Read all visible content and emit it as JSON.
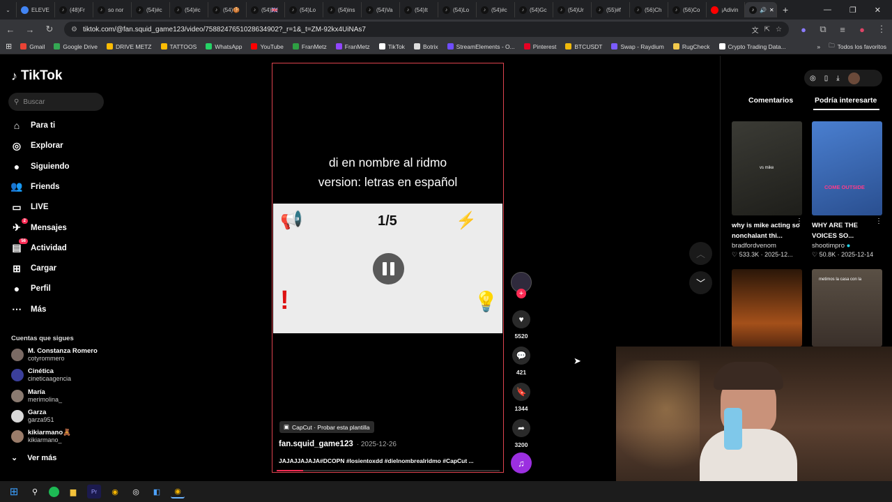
{
  "browser": {
    "tabs": [
      {
        "label": "ELEVE",
        "icon": "globe-icon"
      },
      {
        "label": "(48)Fr",
        "icon": "tiktok-icon"
      },
      {
        "label": "so nor",
        "icon": "tiktok-icon"
      },
      {
        "label": "(54)#c",
        "icon": "tiktok-icon"
      },
      {
        "label": "(54)#c",
        "icon": "tiktok-icon"
      },
      {
        "label": "(54)🍪",
        "icon": "tiktok-icon"
      },
      {
        "label": "(54)🇬🇧",
        "icon": "tiktok-icon"
      },
      {
        "label": "(54)Lo",
        "icon": "tiktok-icon"
      },
      {
        "label": "(54)ins",
        "icon": "tiktok-icon"
      },
      {
        "label": "(54)Va",
        "icon": "tiktok-icon"
      },
      {
        "label": "(54)It",
        "icon": "tiktok-icon"
      },
      {
        "label": "(54)Lo",
        "icon": "tiktok-icon"
      },
      {
        "label": "(54)#c",
        "icon": "tiktok-icon"
      },
      {
        "label": "(54)Gc",
        "icon": "tiktok-icon"
      },
      {
        "label": "(54)Ur",
        "icon": "tiktok-icon"
      },
      {
        "label": "(55)#f",
        "icon": "tiktok-icon"
      },
      {
        "label": "(56)Ch",
        "icon": "tiktok-icon"
      },
      {
        "label": "(56)Co",
        "icon": "tiktok-icon"
      },
      {
        "label": "¡Adivin",
        "icon": "youtube-icon"
      }
    ],
    "url": "tiktok.com/@fan.squid_game123/video/7588247651028634902?_r=1&_t=ZM-92kx4UiNAs7",
    "bookmarks": [
      {
        "label": "Gmail",
        "color": "#ea4335"
      },
      {
        "label": "Google Drive",
        "color": "#34a853"
      },
      {
        "label": "DRIVE METZ",
        "color": "#fbbc04"
      },
      {
        "label": "TATTOOS",
        "color": "#fbbc04"
      },
      {
        "label": "WhatsApp",
        "color": "#25d366"
      },
      {
        "label": "YouTube",
        "color": "#ff0000"
      },
      {
        "label": "FranMetz",
        "color": "#2ea043"
      },
      {
        "label": "FranMetz",
        "color": "#9146ff"
      },
      {
        "label": "TikTok",
        "color": "#ffffff"
      },
      {
        "label": "Botrix",
        "color": "#dddddd"
      },
      {
        "label": "StreamElements - O...",
        "color": "#6f4dff"
      },
      {
        "label": "Pinterest",
        "color": "#e60023"
      },
      {
        "label": "BTCUSDT",
        "color": "#f0b90b"
      },
      {
        "label": "Swap - Raydium",
        "color": "#7b5cff"
      },
      {
        "label": "RugCheck",
        "color": "#f2c94c"
      },
      {
        "label": "Crypto Trading Data...",
        "color": "#ffffff"
      }
    ],
    "all_bookmarks": "Todos los favoritos"
  },
  "sidebar": {
    "logo": "TikTok",
    "search_placeholder": "Buscar",
    "nav": [
      {
        "label": "Para ti",
        "icon": "home-icon"
      },
      {
        "label": "Explorar",
        "icon": "compass-icon"
      },
      {
        "label": "Siguiendo",
        "icon": "following-icon"
      },
      {
        "label": "Friends",
        "icon": "friends-icon"
      },
      {
        "label": "LIVE",
        "icon": "live-icon"
      },
      {
        "label": "Mensajes",
        "icon": "messages-icon",
        "badge": "2"
      },
      {
        "label": "Actividad",
        "icon": "activity-icon",
        "badge": "56"
      },
      {
        "label": "Cargar",
        "icon": "upload-icon"
      },
      {
        "label": "Perfil",
        "icon": "profile-icon"
      },
      {
        "label": "Más",
        "icon": "more-icon"
      }
    ],
    "following_title": "Cuentas que sigues",
    "accounts": [
      {
        "name": "M. Constanza Romero",
        "handle": "cotyrommero"
      },
      {
        "name": "Cinética",
        "handle": "cineticaagencia"
      },
      {
        "name": "María",
        "handle": "merimolina_"
      },
      {
        "name": "Garza",
        "handle": "garza951"
      },
      {
        "name": "kikiarmano🧸",
        "handle": "kikiarmano_"
      }
    ],
    "see_more": "Ver más"
  },
  "video": {
    "overlay_line1": "di en nombre al ridmo",
    "overlay_line2": "version: letras en español",
    "counter": "1/5",
    "capcut_label": "CapCut · Probar esta plantilla",
    "author": "fan.squid_game123",
    "date": "· 2025-12-26",
    "caption": "JAJAJJAJAJA#DCOPN #losientoxdd #dielnombrealridmo #CapCut ...",
    "progress": 0.12
  },
  "actions": {
    "likes": "5520",
    "comments": "421",
    "saves": "1344",
    "shares": "3200"
  },
  "right_panel": {
    "tab_comments": "Comentarios",
    "tab_suggestions": "Podría interesarte",
    "cards": [
      {
        "title": "why is mike acting so nonchalant thi...",
        "overlay": "vs mike",
        "author": "bradfordvenom",
        "likes": "533.3K",
        "date": "2025-12..."
      },
      {
        "title": "WHY ARE THE VOICES SO...",
        "overlay": "COME OUTSIDE",
        "author": "shootimpro",
        "likes": "50.8K",
        "date": "2025-12-14"
      },
      {
        "title": "",
        "overlay": "",
        "author": "",
        "likes": "",
        "date": ""
      },
      {
        "title": "",
        "overlay": "metimos la casa con la",
        "author": "",
        "likes": "",
        "date": ""
      }
    ]
  },
  "colors": {
    "accent": "#fe2c55",
    "background": "#000000",
    "music_disc": "#9b2fe0"
  }
}
